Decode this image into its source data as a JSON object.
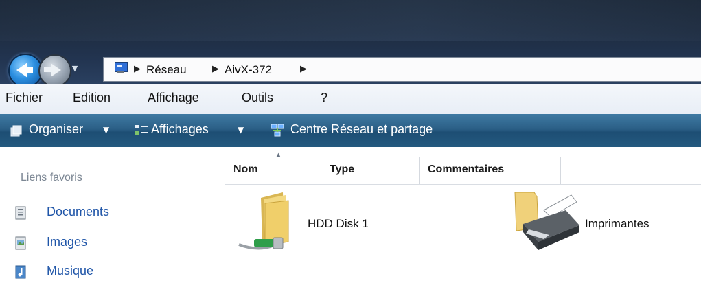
{
  "navigation": {
    "back_icon": "back-arrow-icon",
    "forward_icon": "forward-arrow-icon",
    "history_dropdown_icon": "chevron-down-icon"
  },
  "address_bar": {
    "location_icon": "network-computer-icon",
    "breadcrumbs": [
      "Réseau",
      "AivX-372"
    ]
  },
  "menu": {
    "items": [
      "Fichier",
      "Edition",
      "Affichage",
      "Outils",
      "?"
    ]
  },
  "toolbar": {
    "organize_label": "Organiser",
    "views_label": "Affichages",
    "network_center_label": "Centre Réseau et partage"
  },
  "sidebar": {
    "title": "Liens favoris",
    "items": [
      {
        "label": "Documents",
        "icon": "documents-icon"
      },
      {
        "label": "Images",
        "icon": "images-icon"
      },
      {
        "label": "Musique",
        "icon": "music-icon"
      }
    ]
  },
  "columns": [
    "Nom",
    "Type",
    "Commentaires"
  ],
  "items": [
    {
      "label": "HDD Disk 1",
      "icon": "network-share-folder-icon"
    },
    {
      "label": "Imprimantes",
      "icon": "printer-folder-icon"
    }
  ],
  "colors": {
    "command_bar": "#2b5f86",
    "link": "#1f55a8",
    "title_band": "#1e2d42"
  }
}
